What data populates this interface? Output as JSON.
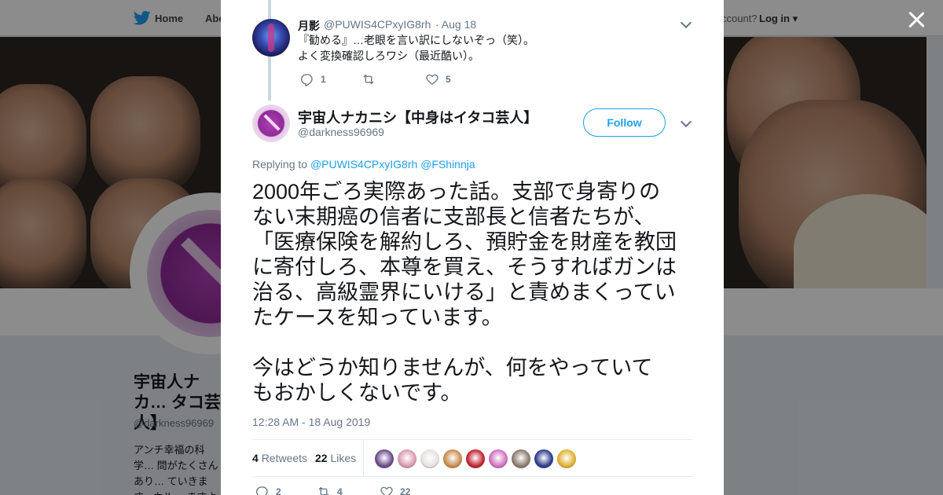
{
  "background": {
    "nav": {
      "home": "Home",
      "about": "Abo",
      "account": "ccount?",
      "login": "Log in"
    },
    "profile": {
      "name": "宇宙人ナカ… タコ芸人】",
      "handle": "@darkness96969",
      "bio": "アンチ幸福の科学… 問がたくさんあり… ていきます。カル… ますように、真面"
    }
  },
  "parent_tweet": {
    "name": "月影",
    "handle": "@PUWIS4CPxyIG8rh",
    "date": "· Aug 18",
    "text_line1": "『勧める』…老眼を言い訳にしないぞっ（笑）。",
    "text_line2": "よく変換確認しろワシ（最近酷い）。",
    "replies": "1",
    "retweets": "",
    "likes": "5"
  },
  "main_tweet": {
    "name": "宇宙人ナカニシ【中身はイタコ芸人】",
    "handle": "@darkness96969",
    "follow_label": "Follow",
    "replying_to_label": "Replying to",
    "replying_to_1": "@PUWIS4CPxyIG8rh",
    "replying_to_2": "@FShinnja",
    "text": "2000年ごろ実際あった話。支部で身寄りの\nない末期癌の信者に支部長と信者たちが、\n「医療保険を解約しろ、預貯金を財産を教団\nに寄付しろ、本尊を買え、そうすればガンは\n治る、高級霊界にいける」と責めまくってい\nたケースを知っています。\n\n今はどうか知りませんが、何をやっていて\nもおかしくないです。",
    "timestamp": "12:28 AM - 18 Aug 2019",
    "retweet_count": "4",
    "retweet_label": "Retweets",
    "like_count": "22",
    "like_label": "Likes",
    "reply_count_bottom": "2",
    "retweet_count_bottom": "4",
    "like_count_bottom": "22"
  },
  "liker_avatar_colors": [
    "#6a4a8a",
    "#d89ab0",
    "#e8e0e0",
    "#c88a4a",
    "#c02030",
    "#d070c0",
    "#8a7a6a",
    "#2a3a8a",
    "#e0b030"
  ],
  "colors": {
    "accent": "#1da1f2",
    "text": "#14171a",
    "muted": "#657786"
  }
}
